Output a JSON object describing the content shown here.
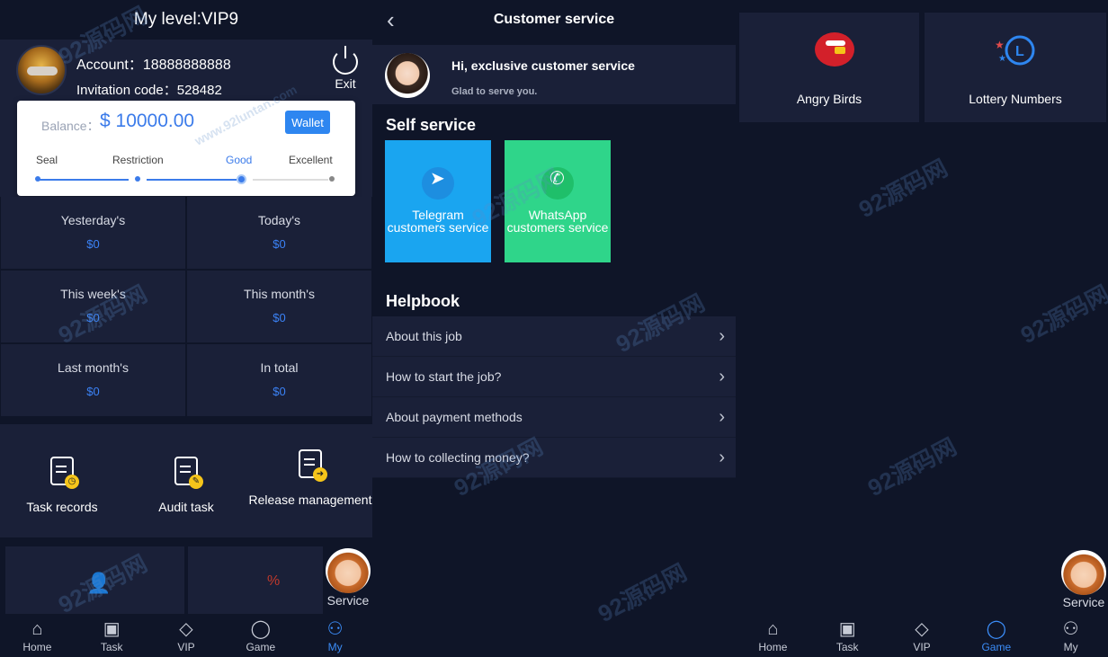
{
  "my_panel": {
    "header": "My level:VIP9",
    "account_label": "Account：",
    "account_value": "18888888888",
    "invite_label": "Invitation code：",
    "invite_value": "528482",
    "exit_label": "Exit",
    "balance_label": "Balance：",
    "balance_value": "$ 10000.00",
    "wallet_label": "Wallet",
    "levels": [
      "Seal",
      "Restriction",
      "Good",
      "Excellent"
    ],
    "active_level": "Good",
    "stats": [
      {
        "title": "Yesterday's",
        "value": "$0"
      },
      {
        "title": "Today's",
        "value": "$0"
      },
      {
        "title": "This week's",
        "value": "$0"
      },
      {
        "title": "This month's",
        "value": "$0"
      },
      {
        "title": "Last month's",
        "value": "$0"
      },
      {
        "title": "In total",
        "value": "$0"
      }
    ],
    "actions": [
      {
        "label": "Task records",
        "icon": "task-records-icon"
      },
      {
        "label": "Audit task",
        "icon": "audit-task-icon"
      },
      {
        "label": "Release management",
        "icon": "release-management-icon"
      }
    ],
    "service_label": "Service",
    "tabs": [
      {
        "label": "Home",
        "icon": "home-icon"
      },
      {
        "label": "Task",
        "icon": "task-icon"
      },
      {
        "label": "VIP",
        "icon": "diamond-icon"
      },
      {
        "label": "Game",
        "icon": "game-icon"
      },
      {
        "label": "My",
        "icon": "user-icon"
      }
    ],
    "active_tab": "My"
  },
  "service_panel": {
    "header": "Customer service",
    "greeting": "Hi, exclusive customer service",
    "greeting_sub": "Glad to serve you.",
    "self_service_title": "Self service",
    "self_service": [
      {
        "label": "Telegram customers service",
        "color": "#1aa5f0",
        "icon": "telegram-icon"
      },
      {
        "label": "WhatsApp customers service",
        "color": "#2fd58a",
        "icon": "whatsapp-icon"
      }
    ],
    "helpbook_title": "Helpbook",
    "helpbook": [
      "About this job",
      "How to start the job?",
      "About payment methods",
      "How to collecting money?"
    ]
  },
  "game_panel": {
    "games": [
      {
        "label": "Angry Birds",
        "icon": "angry-bird-icon"
      },
      {
        "label": "Lottery Numbers",
        "icon": "lottery-icon"
      }
    ],
    "service_label": "Service",
    "tabs": [
      {
        "label": "Home",
        "icon": "home-icon"
      },
      {
        "label": "Task",
        "icon": "task-icon"
      },
      {
        "label": "VIP",
        "icon": "diamond-icon"
      },
      {
        "label": "Game",
        "icon": "game-icon"
      },
      {
        "label": "My",
        "icon": "user-icon"
      }
    ],
    "active_tab": "Game"
  },
  "watermark": {
    "brand": "92源码网",
    "url": "www.92luntan.com"
  },
  "colors": {
    "accent": "#3b82f6",
    "panel_bg": "#1a2038",
    "page_bg": "#0f1528"
  }
}
